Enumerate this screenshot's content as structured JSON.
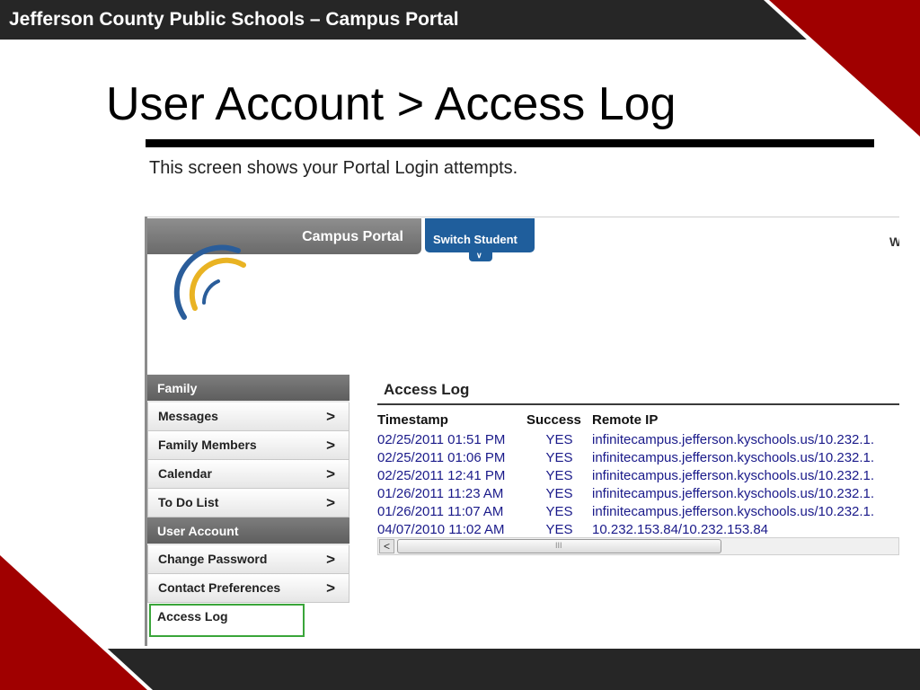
{
  "slide": {
    "header": "Jefferson County Public Schools – Campus Portal",
    "title": "User Account > Access Log",
    "caption": "This screen shows your Portal Login  attempts."
  },
  "colors": {
    "accent_red": "#a00000",
    "dark_bar": "#262626",
    "portal_blue": "#1f5e9c",
    "highlight_green": "#3aa53a"
  },
  "portal": {
    "title_tab": "Campus Portal",
    "switch_student": "Switch Student",
    "cut_text": "W"
  },
  "sidebar": {
    "family_header": "Family",
    "family_items": [
      {
        "label": "Messages",
        "icon": "chevron-right-icon"
      },
      {
        "label": "Family Members",
        "icon": "chevron-right-icon"
      },
      {
        "label": "Calendar",
        "icon": "chevron-right-icon"
      },
      {
        "label": "To Do List",
        "icon": "chevron-right-icon"
      }
    ],
    "account_header": "User Account",
    "account_items": [
      {
        "label": "Change Password",
        "icon": "chevron-right-icon"
      },
      {
        "label": "Contact Preferences",
        "icon": "chevron-right-icon"
      },
      {
        "label": "Access Log",
        "selected": true
      }
    ],
    "arrow_glyph": ">"
  },
  "access_log": {
    "title": "Access Log",
    "columns": [
      "Timestamp",
      "Success",
      "Remote IP"
    ],
    "rows": [
      [
        "02/25/2011 01:51 PM",
        "YES",
        "infinitecampus.jefferson.kyschools.us/10.232.1."
      ],
      [
        "02/25/2011 01:06 PM",
        "YES",
        "infinitecampus.jefferson.kyschools.us/10.232.1."
      ],
      [
        "02/25/2011 12:41 PM",
        "YES",
        "infinitecampus.jefferson.kyschools.us/10.232.1."
      ],
      [
        "01/26/2011 11:23 AM",
        "YES",
        "infinitecampus.jefferson.kyschools.us/10.232.1."
      ],
      [
        "01/26/2011 11:07 AM",
        "YES",
        "infinitecampus.jefferson.kyschools.us/10.232.1."
      ],
      [
        "04/07/2010 11:02 AM",
        "YES",
        "10.232.153.84/10.232.153.84"
      ]
    ],
    "scroll_left_glyph": "<",
    "scroll_grip": "III"
  }
}
